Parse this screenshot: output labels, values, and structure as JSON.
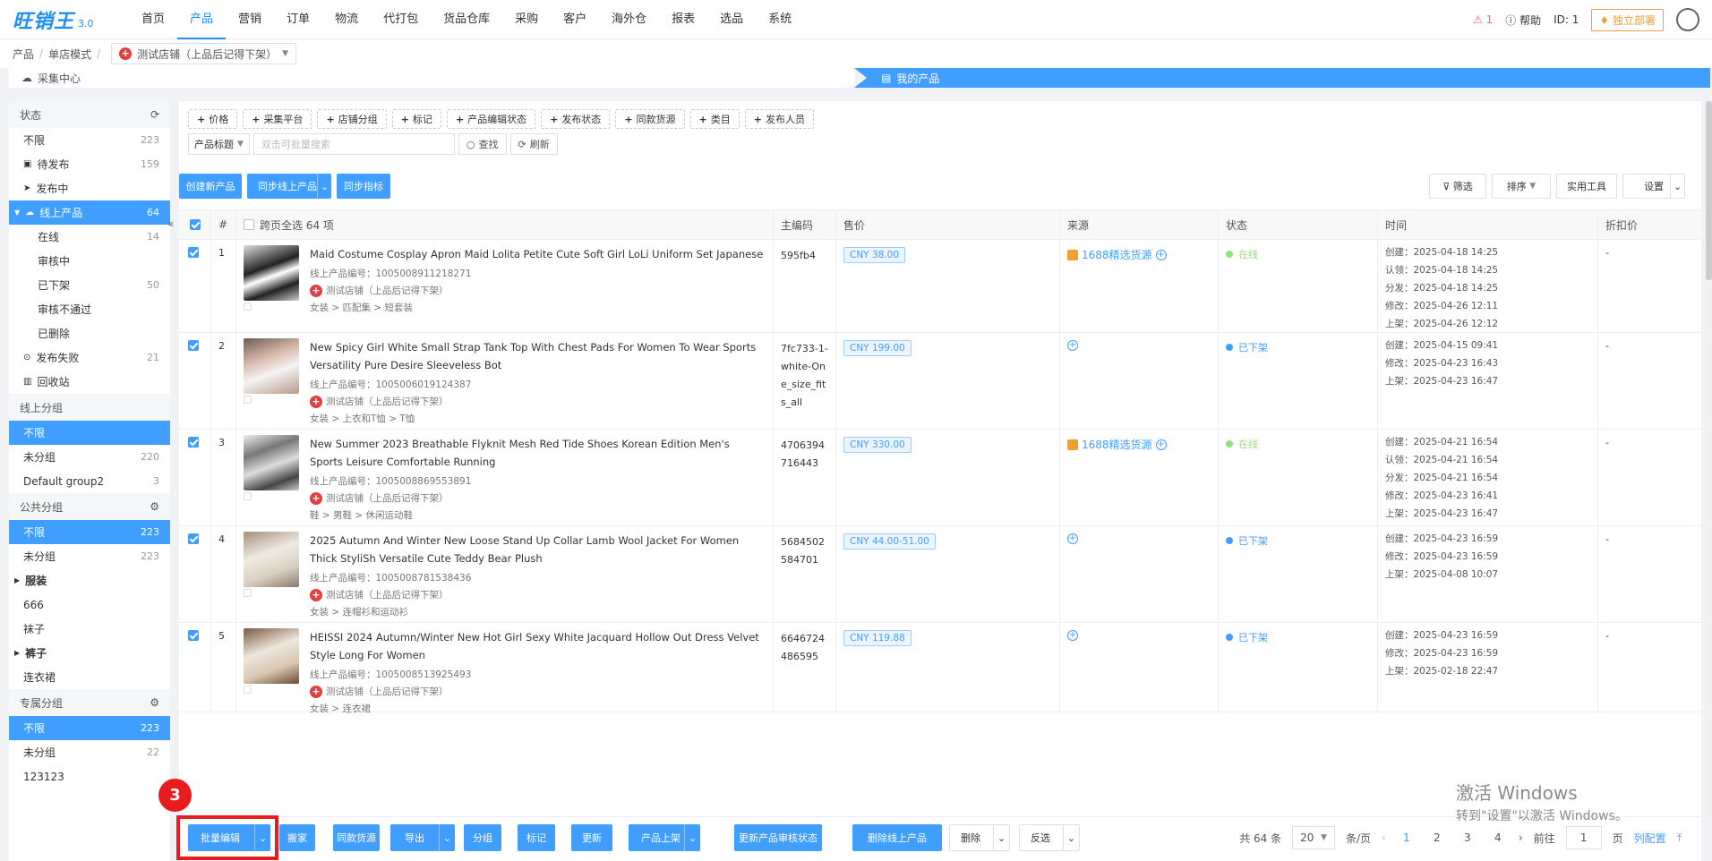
{
  "app": {
    "logo_text": "旺销王",
    "version": "3.0"
  },
  "nav": [
    "首页",
    "产品",
    "营销",
    "订单",
    "物流",
    "代打包",
    "货品仓库",
    "采购",
    "客户",
    "海外仓",
    "报表",
    "选品",
    "系统"
  ],
  "nav_active": 1,
  "topright": {
    "alert": "1",
    "help": "帮助",
    "id": "ID: 1",
    "deploy": "独立部署"
  },
  "breadcrumb": {
    "a": "产品",
    "b": "单店模式",
    "store": "测试店铺（上品后记得下架）"
  },
  "steps": {
    "left": "采集中心",
    "right": "我的产品"
  },
  "sidebar": {
    "status_title": "状态",
    "status_items": [
      {
        "label": "不限",
        "count": "223"
      },
      {
        "label": "待发布",
        "count": "159"
      },
      {
        "label": "发布中",
        "count": ""
      },
      {
        "label": "线上产品",
        "count": "64"
      },
      {
        "label": "在线",
        "count": "14"
      },
      {
        "label": "审核中",
        "count": ""
      },
      {
        "label": "已下架",
        "count": "50"
      },
      {
        "label": "审核不通过",
        "count": ""
      },
      {
        "label": "已删除",
        "count": ""
      },
      {
        "label": "发布失败",
        "count": "21"
      },
      {
        "label": "回收站",
        "count": ""
      }
    ],
    "online_group_title": "线上分组",
    "online_group_items": [
      {
        "label": "不限",
        "count": ""
      },
      {
        "label": "未分组",
        "count": "220"
      },
      {
        "label": "Default group2",
        "count": "3"
      }
    ],
    "public_group_title": "公共分组",
    "public_group_items": [
      {
        "label": "不限",
        "count": "223"
      },
      {
        "label": "未分组",
        "count": "223"
      },
      {
        "label": "服装",
        "count": ""
      },
      {
        "label": "666",
        "count": ""
      },
      {
        "label": "袜子",
        "count": ""
      },
      {
        "label": "裤子",
        "count": ""
      },
      {
        "label": "连衣裙",
        "count": ""
      }
    ],
    "private_group_title": "专属分组",
    "private_group_items": [
      {
        "label": "不限",
        "count": "223"
      },
      {
        "label": "未分组",
        "count": "22"
      },
      {
        "label": "123123",
        "count": ""
      }
    ]
  },
  "filters": [
    "价格",
    "采集平台",
    "店铺分组",
    "标记",
    "产品编辑状态",
    "发布状态",
    "同款货源",
    "类目",
    "发布人员"
  ],
  "search": {
    "select": "产品标题",
    "placeholder": "双击可批量搜索",
    "search_btn": "查找",
    "refresh_btn": "刷新"
  },
  "actions": {
    "create": "创建新产品",
    "sync": "同步线上产品",
    "sync_metrics": "同步指标",
    "filter": "筛选",
    "sort": "排序",
    "tools": "实用工具",
    "settings": "设置"
  },
  "table": {
    "headers": [
      "#",
      "跨页全选 64 项",
      "主编码",
      "售价",
      "来源",
      "状态",
      "时间",
      "折扣价"
    ],
    "rows": [
      {
        "num": "1",
        "title": "Maid Costume Cosplay Apron Maid Lolita Petite Cute Soft Girl LoLi Uniform Set Japanese",
        "pid": "线上产品编号：1005008911218271",
        "store": "测试店铺（上品后记得下架）",
        "cat": "女装 > 匹配集 > 短套装",
        "code": "595fb4",
        "price": "CNY  38.00",
        "source": "1688精选货源",
        "status": "在线",
        "times": [
          "创建：2025-04-18 14:25",
          "认领：2025-04-18 14:25",
          "分发：2025-04-18 14:25",
          "修改：2025-04-26 12:11",
          "上架：2025-04-26 12:12"
        ],
        "discount": "-"
      },
      {
        "num": "2",
        "title": "New Spicy Girl White Small Strap Tank Top With Chest Pads For Women To Wear Sports Versatility Pure Desire Sleeveless Bot",
        "pid": "线上产品编号：1005006019124387",
        "store": "测试店铺（上品后记得下架）",
        "cat": "女装 > 上衣和T恤 > T恤",
        "code": "7fc733-1-white-One_size_fits_all",
        "price": "CNY  199.00",
        "source": "",
        "status": "已下架",
        "times": [
          "创建：2025-04-15 09:41",
          "修改：2025-04-23 16:43",
          "上架：2025-04-23 16:47"
        ],
        "discount": "-"
      },
      {
        "num": "3",
        "title": "New Summer 2023 Breathable Flyknit Mesh Red Tide Shoes Korean Edition Men's Sports Leisure Comfortable Running",
        "pid": "线上产品编号：1005008869553891",
        "store": "测试店铺（上品后记得下架）",
        "cat": "鞋 > 男鞋 > 休闲运动鞋",
        "code": "4706394716443",
        "price": "CNY  330.00",
        "source": "1688精选货源",
        "status": "在线",
        "times": [
          "创建：2025-04-21 16:54",
          "认领：2025-04-21 16:54",
          "分发：2025-04-21 16:54",
          "修改：2025-04-23 16:41",
          "上架：2025-04-23 16:47"
        ],
        "discount": "-"
      },
      {
        "num": "4",
        "title": "2025 Autumn And Winter New Loose Stand Up Collar Lamb Wool Jacket For Women Thick StyliSh Versatile Cute Teddy Bear Plush",
        "pid": "线上产品编号：1005008781538436",
        "store": "测试店铺（上品后记得下架）",
        "cat": "女装 > 连帽衫和运动衫",
        "code": "5684502584701",
        "price": "CNY  44.00-51.00",
        "source": "",
        "status": "已下架",
        "times": [
          "创建：2025-04-23 16:59",
          "修改：2025-04-23 16:59",
          "上架：2025-04-08 10:07"
        ],
        "discount": "-"
      },
      {
        "num": "5",
        "title": "HEISSI 2024 Autumn/Winter New Hot Girl Sexy White Jacquard Hollow Out Dress Velvet Style Long For Women",
        "pid": "线上产品编号：1005008513925493",
        "store": "测试店铺（上品后记得下架）",
        "cat": "女装 > 连衣裙",
        "code": "6646724486595",
        "price": "CNY  119.88",
        "source": "",
        "status": "已下架",
        "times": [
          "创建：2025-04-23 16:59",
          "修改：2025-04-23 16:59",
          "上架：2025-02-18 22:47"
        ],
        "discount": "-"
      }
    ]
  },
  "bottom": {
    "batch_edit": "批量编辑",
    "move": "搬家",
    "same_source": "同款货源",
    "export": "导出",
    "group": "分组",
    "mark": "标记",
    "update": "更新",
    "list": "产品上架",
    "update_review": "更新产品审核状态",
    "delete_online": "删除线上产品",
    "delete": "删除",
    "invert": "反选",
    "total": "共 64 条",
    "per_page": "20",
    "per_page_unit": "条/页",
    "pages": [
      "1",
      "2",
      "3",
      "4"
    ],
    "goto": "前往",
    "goto_val": "1",
    "page_unit": "页",
    "col_config": "列配置"
  },
  "annotation_number": "3",
  "watermark": {
    "line1": "激活 Windows",
    "line2": "转到\"设置\"以激活 Windows。"
  },
  "colors": {
    "primary": "#409eff",
    "online": "#67c23a",
    "offline": "#409eff",
    "marker": "#e81c1c"
  }
}
